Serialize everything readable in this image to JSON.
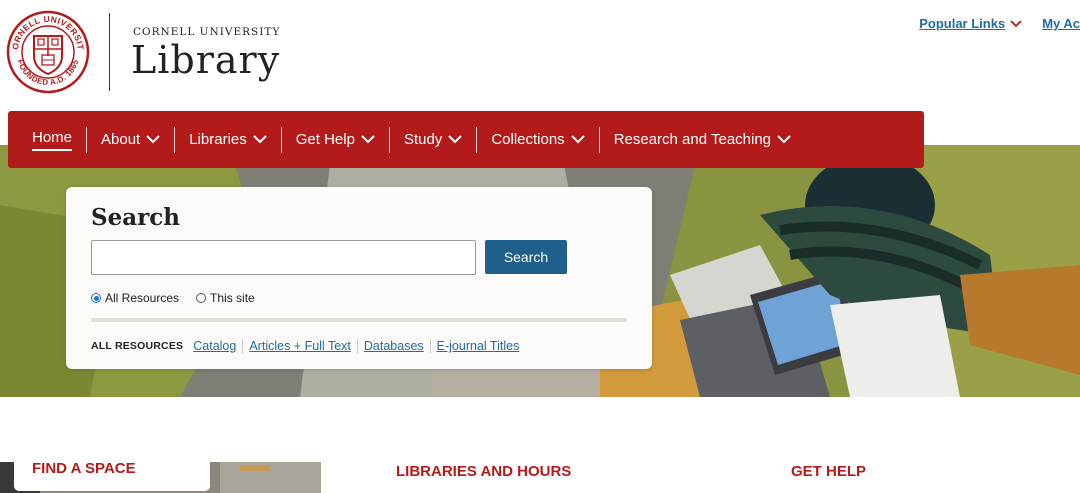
{
  "header": {
    "org_line": "CORNELL UNIVERSITY",
    "title": "Library",
    "seal_text_top": "CORNELL UNIVERSITY",
    "seal_text_bottom": "FOUNDED A.D. 1865"
  },
  "utility_nav": [
    {
      "label": "Popular Links",
      "icon": "chevron-down-icon"
    },
    {
      "label": "My Ac"
    }
  ],
  "main_nav": [
    {
      "label": "Home",
      "active": true
    },
    {
      "label": "About",
      "icon": "chevron-down-icon"
    },
    {
      "label": "Libraries",
      "icon": "chevron-down-icon"
    },
    {
      "label": "Get Help",
      "icon": "chevron-down-icon"
    },
    {
      "label": "Study",
      "icon": "chevron-down-icon"
    },
    {
      "label": "Collections",
      "icon": "chevron-down-icon"
    },
    {
      "label": "Research and Teaching",
      "icon": "chevron-down-icon"
    }
  ],
  "search": {
    "title": "Search",
    "input_value": "",
    "placeholder": "",
    "button_label": "Search",
    "scope_options": [
      {
        "label": "All Resources",
        "selected": true
      },
      {
        "label": "This site",
        "selected": false
      }
    ],
    "resources_label": "ALL RESOURCES",
    "resource_links": [
      "Catalog",
      "Articles + Full Text",
      "Databases",
      "E-journal Titles"
    ]
  },
  "sections": {
    "find_a_space": "FIND A SPACE",
    "libraries_and_hours": "LIBRARIES AND HOURS",
    "get_help": "GET HELP"
  },
  "colors": {
    "brand_red": "#b31b1b",
    "link_blue": "#1f6e9e",
    "button_blue": "#1f5f8b"
  }
}
